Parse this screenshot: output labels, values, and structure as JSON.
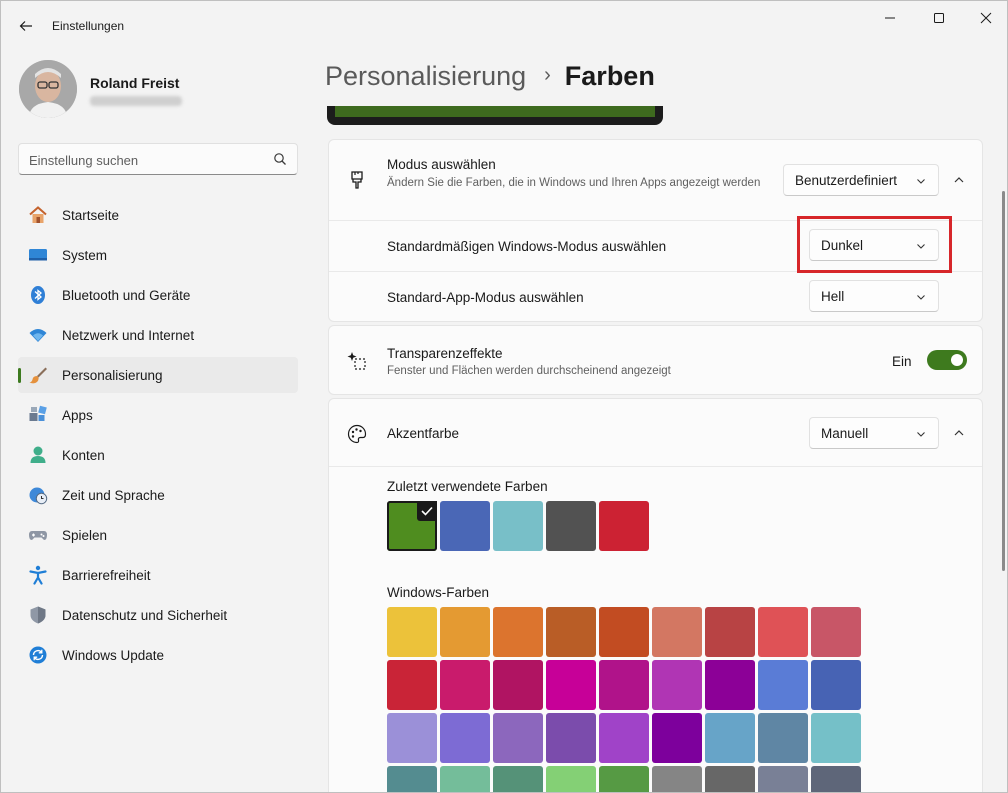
{
  "window": {
    "title": "Einstellungen"
  },
  "profile": {
    "name": "Roland Freist"
  },
  "search": {
    "placeholder": "Einstellung suchen"
  },
  "sidebar": {
    "items": [
      {
        "label": "Startseite",
        "icon": "home-icon"
      },
      {
        "label": "System",
        "icon": "system-icon"
      },
      {
        "label": "Bluetooth und Geräte",
        "icon": "bluetooth-icon"
      },
      {
        "label": "Netzwerk und Internet",
        "icon": "wifi-icon"
      },
      {
        "label": "Personalisierung",
        "icon": "brush-icon",
        "active": true
      },
      {
        "label": "Apps",
        "icon": "apps-icon"
      },
      {
        "label": "Konten",
        "icon": "account-icon"
      },
      {
        "label": "Zeit und Sprache",
        "icon": "clock-globe-icon"
      },
      {
        "label": "Spielen",
        "icon": "gamepad-icon"
      },
      {
        "label": "Barrierefreiheit",
        "icon": "accessibility-icon"
      },
      {
        "label": "Datenschutz und Sicherheit",
        "icon": "shield-icon"
      },
      {
        "label": "Windows Update",
        "icon": "update-icon"
      }
    ]
  },
  "breadcrumb": {
    "parent": "Personalisierung",
    "current": "Farben"
  },
  "mode": {
    "title": "Modus auswählen",
    "description": "Ändern Sie die Farben, die in Windows und Ihren Apps angezeigt werden",
    "value": "Benutzerdefiniert",
    "windows_mode_label": "Standardmäßigen Windows-Modus auswählen",
    "windows_mode_value": "Dunkel",
    "app_mode_label": "Standard-App-Modus auswählen",
    "app_mode_value": "Hell"
  },
  "transparency": {
    "title": "Transparenzeffekte",
    "description": "Fenster und Flächen werden durchscheinend angezeigt",
    "state_label": "Ein",
    "on": true
  },
  "accent": {
    "title": "Akzentfarbe",
    "value": "Manuell",
    "recent_label": "Zuletzt verwendete Farben",
    "recent_colors": [
      "#4f8d1f",
      "#4a67b6",
      "#78bfc8",
      "#525252",
      "#cc2233"
    ],
    "windows_label": "Windows-Farben",
    "windows_colors": [
      "#ecc23a",
      "#e49a32",
      "#dc742e",
      "#b95d26",
      "#c24c22",
      "#d37762",
      "#b84344",
      "#df5256",
      "#c85667",
      "#c92437",
      "#c91b6c",
      "#b01462",
      "#c70098",
      "#b0138a",
      "#b035b4",
      "#8c0097",
      "#5a7cd6",
      "#4763b4",
      "#9b90d8",
      "#7d6bd4",
      "#8c67bd",
      "#7b4cac",
      "#a043c8",
      "#7d009c",
      "#67a4c8",
      "#5f86a4",
      "#75c0c8",
      "#548c90",
      "#74bd9a",
      "#559278",
      "#84d075",
      "#569a44",
      "#858585",
      "#676767",
      "#798096",
      "#5e6679"
    ]
  },
  "colors": {
    "accent": "#3e7a1e",
    "highlight": "#d7262a"
  }
}
